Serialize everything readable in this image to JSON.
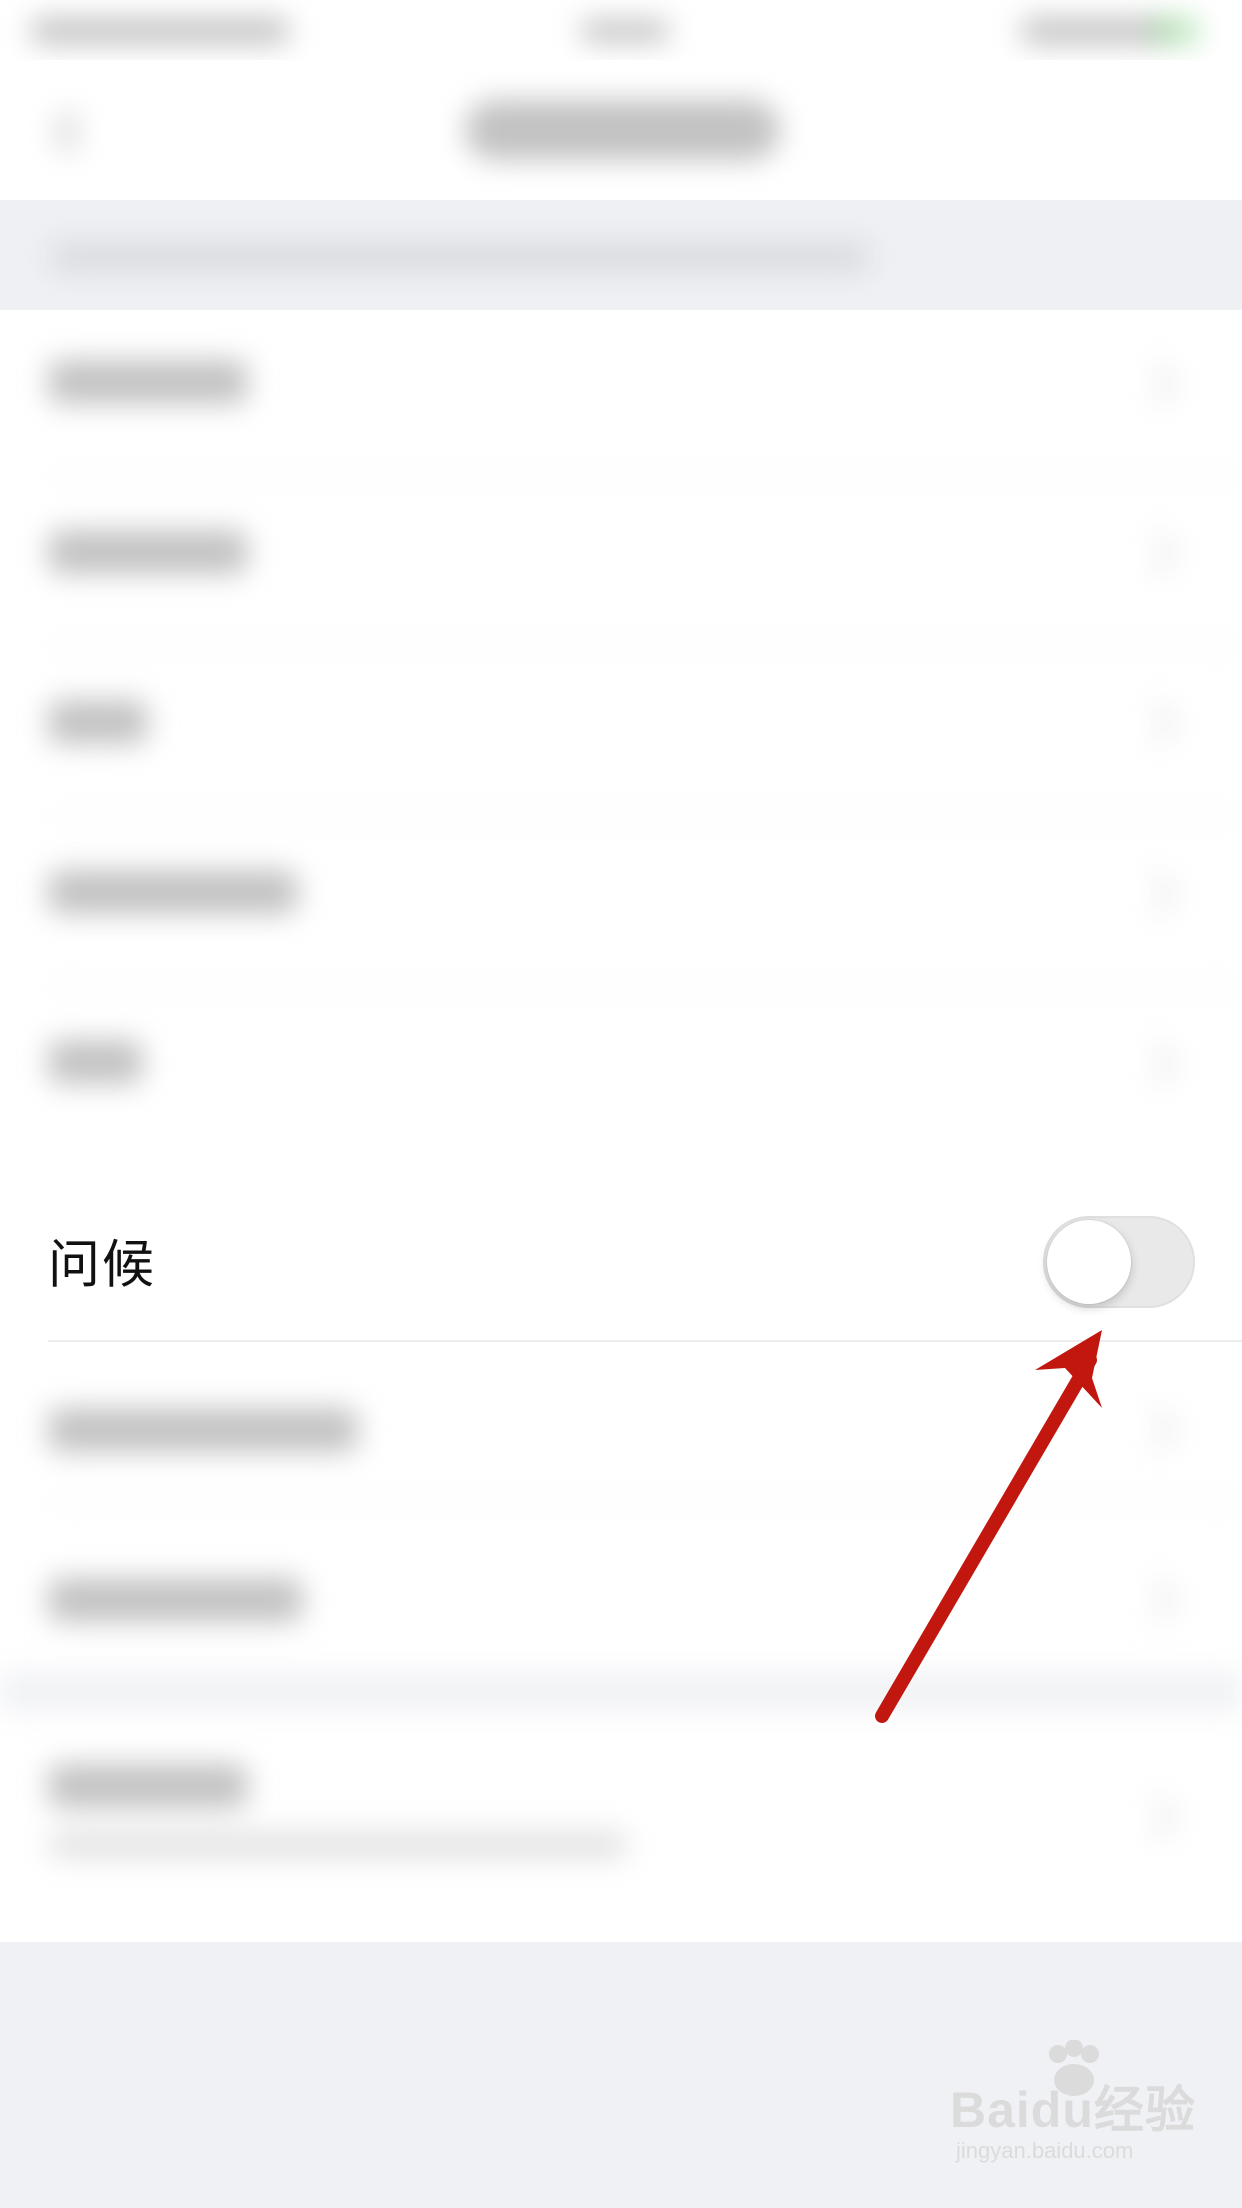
{
  "settings": {
    "greeting_row": {
      "label": "问候",
      "toggle_on": false
    }
  },
  "colors": {
    "toggle_off_track": "#e9e9ea",
    "annotation_arrow": "#c2170f",
    "section_background": "#eef0f4"
  },
  "icons": {
    "annotation": "arrow-icon",
    "watermark": "baidu-paw-icon"
  },
  "watermark": {
    "brand": "Baidu经验",
    "url": "jingyan.baidu.com"
  }
}
